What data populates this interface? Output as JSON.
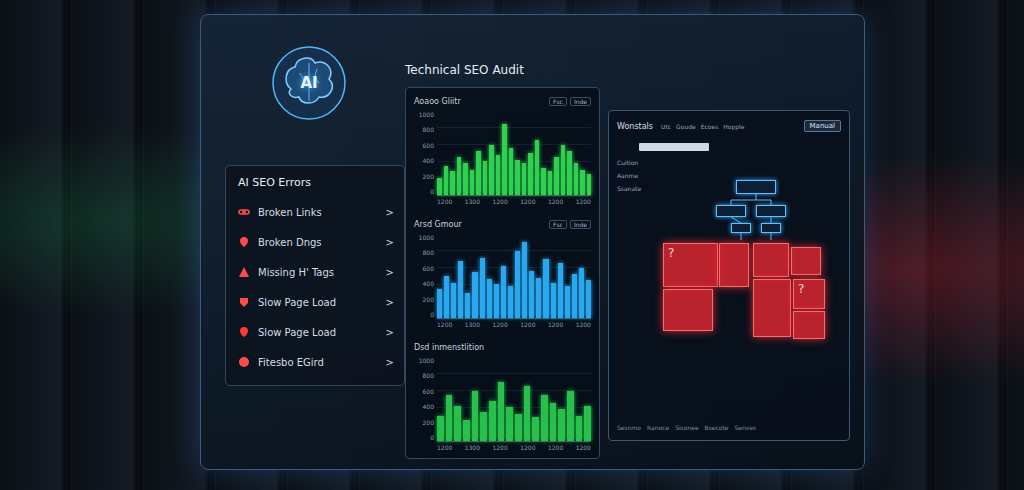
{
  "logo": {
    "text": "AI"
  },
  "title": "Technical SEO Audit",
  "errors": {
    "title": "AI SEO Errors",
    "items": [
      {
        "label": "Broken Links",
        "chevron": ">"
      },
      {
        "label": "Broken Dngs",
        "chevron": ">"
      },
      {
        "label": "Missing H' Tags",
        "chevron": ">"
      },
      {
        "label": "Slow Page Load",
        "chevron": ">"
      },
      {
        "label": "Slow Page Load",
        "chevron": ">"
      },
      {
        "label": "Fitesbo EGird",
        "chevron": ">"
      }
    ]
  },
  "charts": [
    {
      "title": "Aoaoo Gliitr",
      "legend": [
        "Fsc",
        "Inde"
      ],
      "y_ticks": [
        "1000",
        "800",
        "600",
        "400",
        "200",
        "0"
      ],
      "x_ticks": [
        "1200",
        "1300",
        "1200",
        "1200",
        "1200",
        "1200"
      ],
      "series": [
        {
          "color": "#2fd14f",
          "values": [
            200,
            350,
            280,
            450,
            380,
            300,
            520,
            410,
            600,
            480,
            850,
            560,
            420,
            380,
            500,
            650,
            320,
            280,
            450,
            600,
            520,
            380,
            300,
            250
          ]
        }
      ]
    },
    {
      "title": "Arsd Gmour",
      "legend": [
        "Fsc",
        "Inde"
      ],
      "y_ticks": [
        "1000",
        "800",
        "600",
        "400",
        "200",
        "0"
      ],
      "x_ticks": [
        "1200",
        "1300",
        "1200",
        "1200",
        "1200",
        "1200"
      ],
      "series": [
        {
          "color": "#29a8f0",
          "values": [
            350,
            500,
            420,
            680,
            300,
            550,
            720,
            460,
            400,
            620,
            380,
            800,
            900,
            560,
            480,
            700,
            420,
            650,
            380,
            520,
            600,
            450
          ]
        }
      ]
    },
    {
      "title": "Dsd inmenstlition",
      "legend": [],
      "y_ticks": [
        "1000",
        "800",
        "600",
        "400",
        "200",
        "0"
      ],
      "x_ticks": [
        "1200",
        "1300",
        "1200",
        "1200",
        "1200",
        "1200"
      ],
      "series": [
        {
          "color": "#27c04a",
          "values": [
            300,
            550,
            420,
            250,
            600,
            350,
            480,
            700,
            400,
            320,
            650,
            280,
            550,
            450,
            380,
            600,
            300,
            420
          ]
        }
      ]
    }
  ],
  "diagram_panel": {
    "title": "Wonstals",
    "tabs": [
      "Utc",
      "Goude",
      "Ecoes",
      "Hopple"
    ],
    "button": "Manual",
    "rows": [
      "Cuition",
      "Aanme",
      "Ssanate"
    ],
    "nodes": [
      {
        "label": "",
        "kind": "flow"
      },
      {
        "label": "",
        "kind": "flow"
      },
      {
        "label": "",
        "kind": "flow"
      },
      {
        "label": "",
        "kind": "flow"
      },
      {
        "label": "",
        "kind": "flow"
      },
      {
        "label": "?",
        "kind": "error"
      },
      {
        "label": "",
        "kind": "error"
      },
      {
        "label": "",
        "kind": "error"
      },
      {
        "label": "",
        "kind": "error"
      },
      {
        "label": "",
        "kind": "error"
      },
      {
        "label": "",
        "kind": "error"
      },
      {
        "label": "?",
        "kind": "error"
      },
      {
        "label": "",
        "kind": "error"
      }
    ],
    "footer": [
      "Sesnmo",
      "Ranoce",
      "Sisonee",
      "Bsecote",
      "Senves"
    ]
  }
}
